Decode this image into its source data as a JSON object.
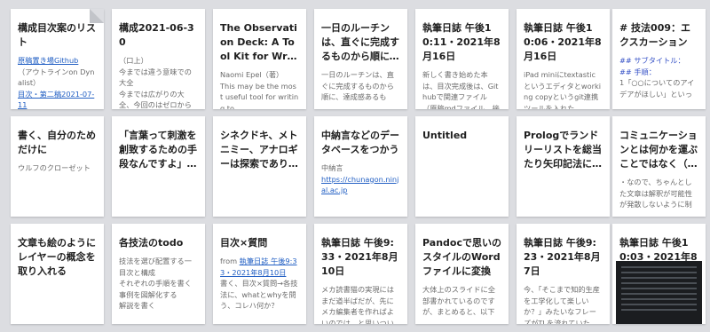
{
  "cards": [
    {
      "title": "構成目次案のリスト",
      "body": [
        {
          "t": "原稿置き場Github",
          "link": true
        },
        {
          "t": "（アウトラインon Dynalist）"
        },
        {
          "t": "目次・第二稿2021-07-11",
          "link": true
        }
      ]
    },
    {
      "title": "構成2021-06-30",
      "body": [
        {
          "t": "（口上）"
        },
        {
          "t": "今までは違う意味での大全"
        },
        {
          "t": "今までは広がりの大全、今回のはゼロから"
        }
      ]
    },
    {
      "title": "The Observation Deck: A Tool Kit for Writers",
      "body": [
        {
          "t": "Naomi Epel（著）"
        },
        {
          "t": "This may be the most useful tool for writing to"
        }
      ]
    },
    {
      "title": "一日のルーチンは、直ぐに完成するものから順に、達成感…",
      "body": [
        {
          "t": "一日のルーチンは、直ぐに完成するものから順に、達成感あるも"
        }
      ]
    },
    {
      "title": "執筆日誌 午後10:11・2021年8月16日",
      "body": [
        {
          "t": "新しく書き始めた本は、目次完成後は、Githubで関連ファイル（原稿mdファイル、接"
        }
      ]
    },
    {
      "title": "執筆日誌 午後10:06・2021年8月16日",
      "body": [
        {
          "t": "iPad miniにtextasticというエディタとworking copyというgit連携ツールを入れた。"
        }
      ]
    },
    {
      "title": "# 技法009：エクスカーション",
      "body": [
        {
          "t": "## サブタイトル：",
          "hdr": true
        },
        {
          "t": "## 手順：",
          "hdr": true
        },
        {
          "t": "1「○○についてのアイデアがほしい」といっ"
        }
      ]
    },
    {
      "title": "書く、自分のためだけに",
      "body": [
        {
          "t": "ウルフのクローゼット"
        }
      ]
    },
    {
      "title": "「言葉って刺激を創致するための手段なんですよ」ライテ…",
      "body": []
    },
    {
      "title": "シネクドキ、メトニミー、アナロギーは探索であり発想法…",
      "body": []
    },
    {
      "title": "中納言などのデータベースをつかう",
      "body": [
        {
          "t": "中納言"
        },
        {
          "t": "https://chunagon.ninjal.ac.jp",
          "link": true
        }
      ]
    },
    {
      "title": "Untitled",
      "body": []
    },
    {
      "title": "Prologでランドリーリストを総当たり矢印記法に変換する",
      "body": []
    },
    {
      "title": "コミュニケーションとは何かを運ぶことではなく（導管メ…",
      "body": [
        {
          "t": "・なので、ちゃんとした文章は解釈が可能性が発散しないように制"
        }
      ]
    },
    {
      "title": "文章も絵のようにレイヤーの概念を取り入れる",
      "body": []
    },
    {
      "title": "各技法のtodo",
      "body": [
        {
          "t": "技法を選び配置する一目次と構成"
        },
        {
          "t": "それぞれの手順を書く"
        },
        {
          "t": "事例を図解化する"
        },
        {
          "t": "解説を書く"
        }
      ]
    },
    {
      "title": "目次×質問",
      "body": [
        {
          "t": "from ",
          "link": false
        },
        {
          "t": "執筆日誌 午後9:33・2021年8月10日",
          "link": true
        },
        {
          "t": "書く、目次×質問→各技法に、whatとwhyを問う、コレハ何か？"
        }
      ]
    },
    {
      "title": "執筆日誌 午後9:33・2021年8月10日",
      "body": [
        {
          "t": "メカ読書猫の実現にはまだ道半ばだが、先にメカ編集者を作ればよいのでは、と思いつい"
        }
      ]
    },
    {
      "title": "Pandocで思いのスタイルのWordファイルに変換",
      "body": [
        {
          "t": "大体上のスライドに全部書かれているのですが、まとめると、以下"
        }
      ]
    },
    {
      "title": "執筆日誌 午後9:23・2021年8月7日",
      "body": [
        {
          "t": "今、「そこまで知的生産を工学化して楽しいか？」みたいなフレーズがTLを流れていた"
        }
      ]
    },
    {
      "title": "執筆日誌 午後10:03・2021年8月4日",
      "body": [],
      "thumb": true
    }
  ]
}
